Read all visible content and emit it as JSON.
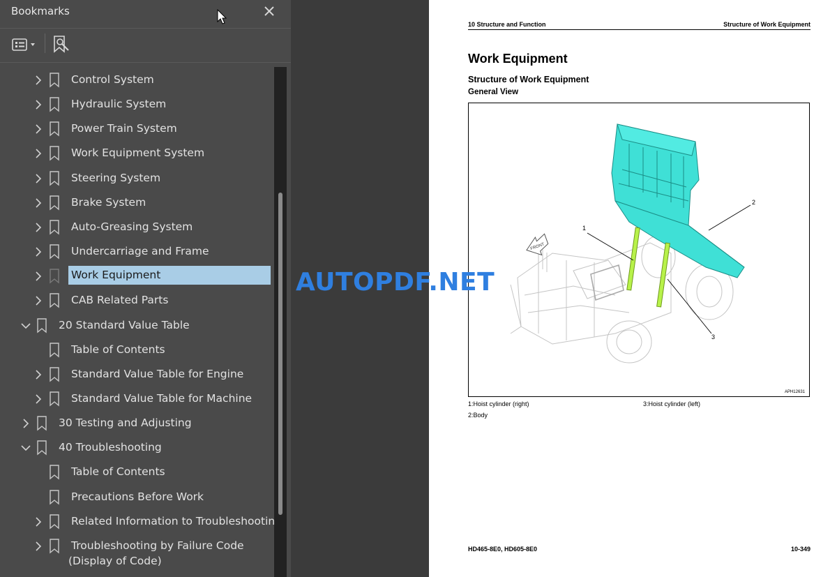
{
  "panel": {
    "title": "Bookmarks",
    "close_icon": "close-icon",
    "toolbar": {
      "options_icon": "list-options-icon",
      "find_icon": "bookmark-search-icon"
    }
  },
  "bookmarks": [
    {
      "label": "Control System",
      "level": 2,
      "chevron": "right",
      "selected": false
    },
    {
      "label": "Hydraulic System",
      "level": 2,
      "chevron": "right",
      "selected": false
    },
    {
      "label": "Power Train System",
      "level": 2,
      "chevron": "right",
      "selected": false
    },
    {
      "label": "Work Equipment System",
      "level": 2,
      "chevron": "right",
      "selected": false
    },
    {
      "label": "Steering System",
      "level": 2,
      "chevron": "right",
      "selected": false
    },
    {
      "label": "Brake System",
      "level": 2,
      "chevron": "right",
      "selected": false
    },
    {
      "label": "Auto-Greasing System",
      "level": 2,
      "chevron": "right",
      "selected": false
    },
    {
      "label": "Undercarriage and Frame",
      "level": 2,
      "chevron": "right",
      "selected": false
    },
    {
      "label": "Work Equipment",
      "level": 2,
      "chevron": "right",
      "selected": true
    },
    {
      "label": "CAB Related Parts",
      "level": 2,
      "chevron": "right",
      "selected": false
    },
    {
      "label": "20 Standard Value Table",
      "level": 1,
      "chevron": "down",
      "selected": false
    },
    {
      "label": "Table of Contents",
      "level": 2,
      "chevron": "",
      "selected": false
    },
    {
      "label": "Standard Value Table for Engine",
      "level": 2,
      "chevron": "right",
      "selected": false
    },
    {
      "label": "Standard Value Table for Machine",
      "level": 2,
      "chevron": "right",
      "selected": false
    },
    {
      "label": "30 Testing and Adjusting",
      "level": 1,
      "chevron": "right",
      "selected": false
    },
    {
      "label": "40 Troubleshooting",
      "level": 1,
      "chevron": "down",
      "selected": false
    },
    {
      "label": "Table of Contents",
      "level": 2,
      "chevron": "",
      "selected": false
    },
    {
      "label": "Precautions Before Work",
      "level": 2,
      "chevron": "",
      "selected": false
    },
    {
      "label": "Related Information to Troubleshooting",
      "level": 2,
      "chevron": "right",
      "selected": false
    },
    {
      "label": "Troubleshooting by Failure Code",
      "label2": "(Display of Code)",
      "level": 2,
      "chevron": "right",
      "selected": false
    }
  ],
  "document": {
    "header_left": "10 Structure and Function",
    "header_right": "Structure of Work Equipment",
    "title": "Work Equipment",
    "subtitle": "Structure of Work Equipment",
    "subtitle2": "General View",
    "figure_code": "APH12631",
    "figure_labels": {
      "one": "1",
      "two": "2",
      "three": "3",
      "front": "FRONT"
    },
    "captions": {
      "c1": "1:Hoist cylinder (right)",
      "c2": "2:Body",
      "c3": "3:Hoist cylinder (left)"
    },
    "footer_left": "HD465-8E0, HD605-8E0",
    "footer_right": "10-349"
  },
  "watermark": "AUTOPDF.NET",
  "colors": {
    "panel_bg": "#4a4a4a",
    "selection": "#a9cde6",
    "body_cyan": "#3fe0d6",
    "cylinder_green": "#b8f24a",
    "watermark": "#2f7fe0"
  }
}
